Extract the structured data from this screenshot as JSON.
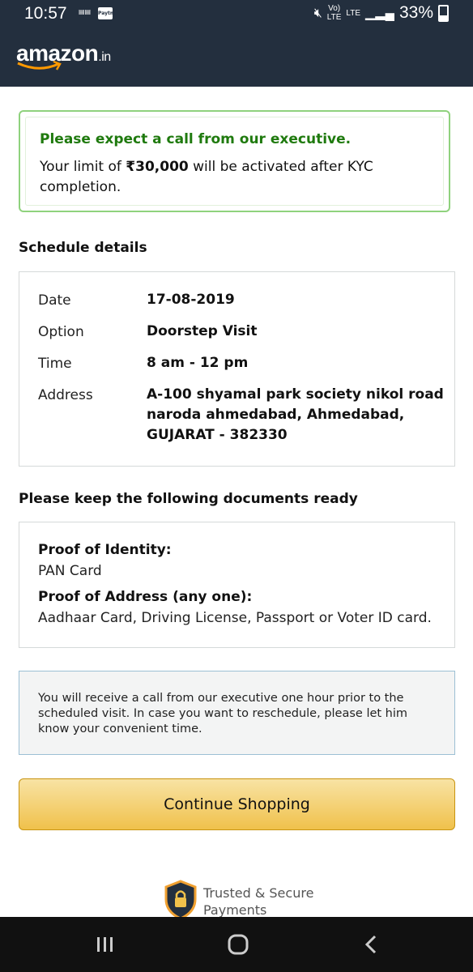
{
  "status_bar": {
    "time": "10:57",
    "battery": "33%",
    "network": "LTE",
    "paytm": "Paytm"
  },
  "header": {
    "logo": "amazon",
    "logo_suffix": ".in"
  },
  "alert": {
    "title": "Please expect a call from our executive.",
    "body_prefix": "Your limit of ",
    "limit": "₹30,000",
    "body_suffix": " will be activated after KYC completion.",
    "color": "#1f7a0e"
  },
  "schedule": {
    "title": "Schedule details",
    "rows": [
      {
        "label": "Date",
        "value": "17-08-2019"
      },
      {
        "label": "Option",
        "value": "Doorstep Visit"
      },
      {
        "label": "Time",
        "value": "8 am - 12 pm"
      },
      {
        "label": "Address",
        "value": "A-100 shyamal park society nikol road naroda ahmedabad, Ahmedabad, GUJARAT - 382330"
      }
    ]
  },
  "documents": {
    "title": "Please keep the following documents ready",
    "identity_heading": "Proof of Identity:",
    "identity_value": "PAN Card",
    "address_heading": "Proof of Address (any one):",
    "address_value": "Aadhaar Card, Driving License, Passport or Voter ID card."
  },
  "notice": {
    "text": "You will receive a call from our executive one hour prior to the scheduled visit. In case you want to reschedule, please let him know your convenient time."
  },
  "cta": {
    "label": "Continue Shopping",
    "color": "#f0c14b"
  },
  "trust_badge": {
    "text": "Trusted & Secure Payments",
    "icon": "lock-shield-icon"
  },
  "nav": {
    "recents": "recent-apps-icon",
    "home": "home-icon",
    "back": "back-icon"
  }
}
